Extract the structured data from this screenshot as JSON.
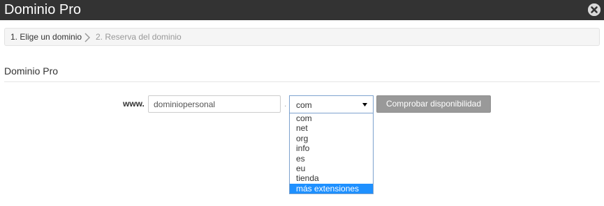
{
  "dialog": {
    "title": "Dominio Pro",
    "close_icon": "close-circle-icon"
  },
  "breadcrumb": {
    "step1": "1. Elige un dominio",
    "separator_icon": "chevron-right-icon",
    "step2": "2. Reserva del dominio"
  },
  "section": {
    "title": "Dominio Pro"
  },
  "form": {
    "www_label": "www.",
    "domain_value": "dominiopersonal",
    "dot": ".",
    "tld_selected": "com",
    "tld_arrow_icon": "caret-down-icon",
    "check_button_label": "Comprobar disponibilidad"
  },
  "dropdown": {
    "options": [
      "com",
      "net",
      "org",
      "info",
      "es",
      "eu",
      "tienda",
      "más extensiones"
    ],
    "highlighted_index": 7,
    "highlight_color": "#1e90ff"
  },
  "colors": {
    "titlebar_bg": "#333333",
    "button_bg": "#999999",
    "select_border": "#7da2ce"
  }
}
